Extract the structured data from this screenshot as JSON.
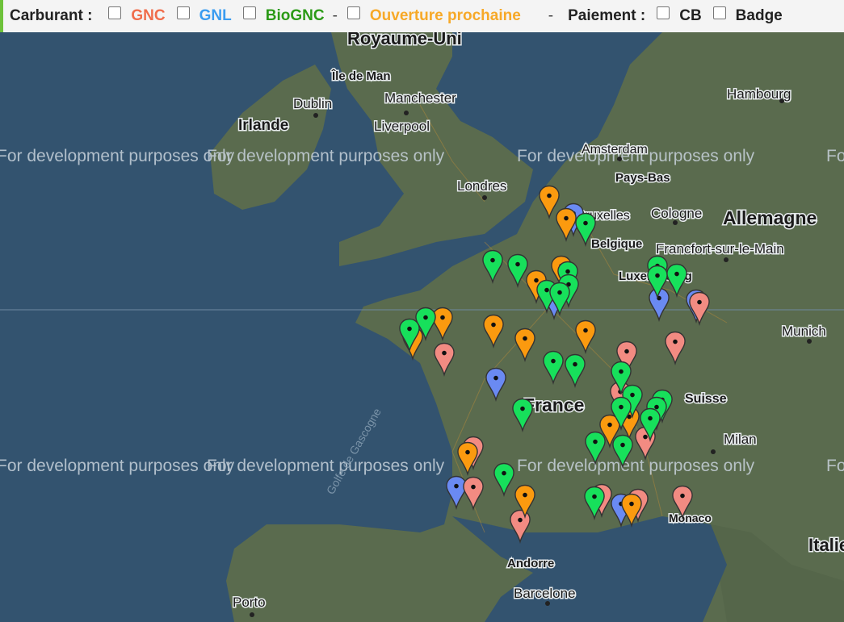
{
  "filters": {
    "carburant_label": "Carburant :",
    "gnc": "GNC",
    "gnl": "GNL",
    "biognc": "BioGNC",
    "separator": "-",
    "ouverture": "Ouverture prochaine",
    "paiement_label": "Paiement :",
    "cb": "CB",
    "badge": "Badge"
  },
  "colors": {
    "gnc": "#f06c4a",
    "gnl": "#3a9cf0",
    "biognc": "#2b9a16",
    "ouverture": "#f7a928",
    "marker_red": "#f28b82",
    "marker_blue": "#6a8af2",
    "marker_green": "#17e05b",
    "marker_orange": "#fb9a0f"
  },
  "map": {
    "watermark": "For development purposes only",
    "labels": {
      "royaume_uni": "Royaume-Uni",
      "ile_de_man": "Île de Man",
      "dublin": "Dublin",
      "irlande": "Irlande",
      "manchester": "Manchester",
      "liverpool": "Liverpool",
      "londres": "Londres",
      "amsterdam": "Amsterdam",
      "pays_bas": "Pays-Bas",
      "hambourg": "Hambourg",
      "bruxelles": "Bruxelles",
      "belgique": "Belgique",
      "cologne": "Cologne",
      "allemagne": "Allemagne",
      "francfort": "Francfort-sur-le-Main",
      "luxembourg": "Luxembourg",
      "munich": "Munich",
      "france": "France",
      "suisse": "Suisse",
      "milan": "Milan",
      "golfe": "Golfe de Gascogne",
      "monaco": "Monaco",
      "andorre": "Andorre",
      "porto": "Porto",
      "barcelone": "Barcelone",
      "italie": "Italie"
    }
  }
}
